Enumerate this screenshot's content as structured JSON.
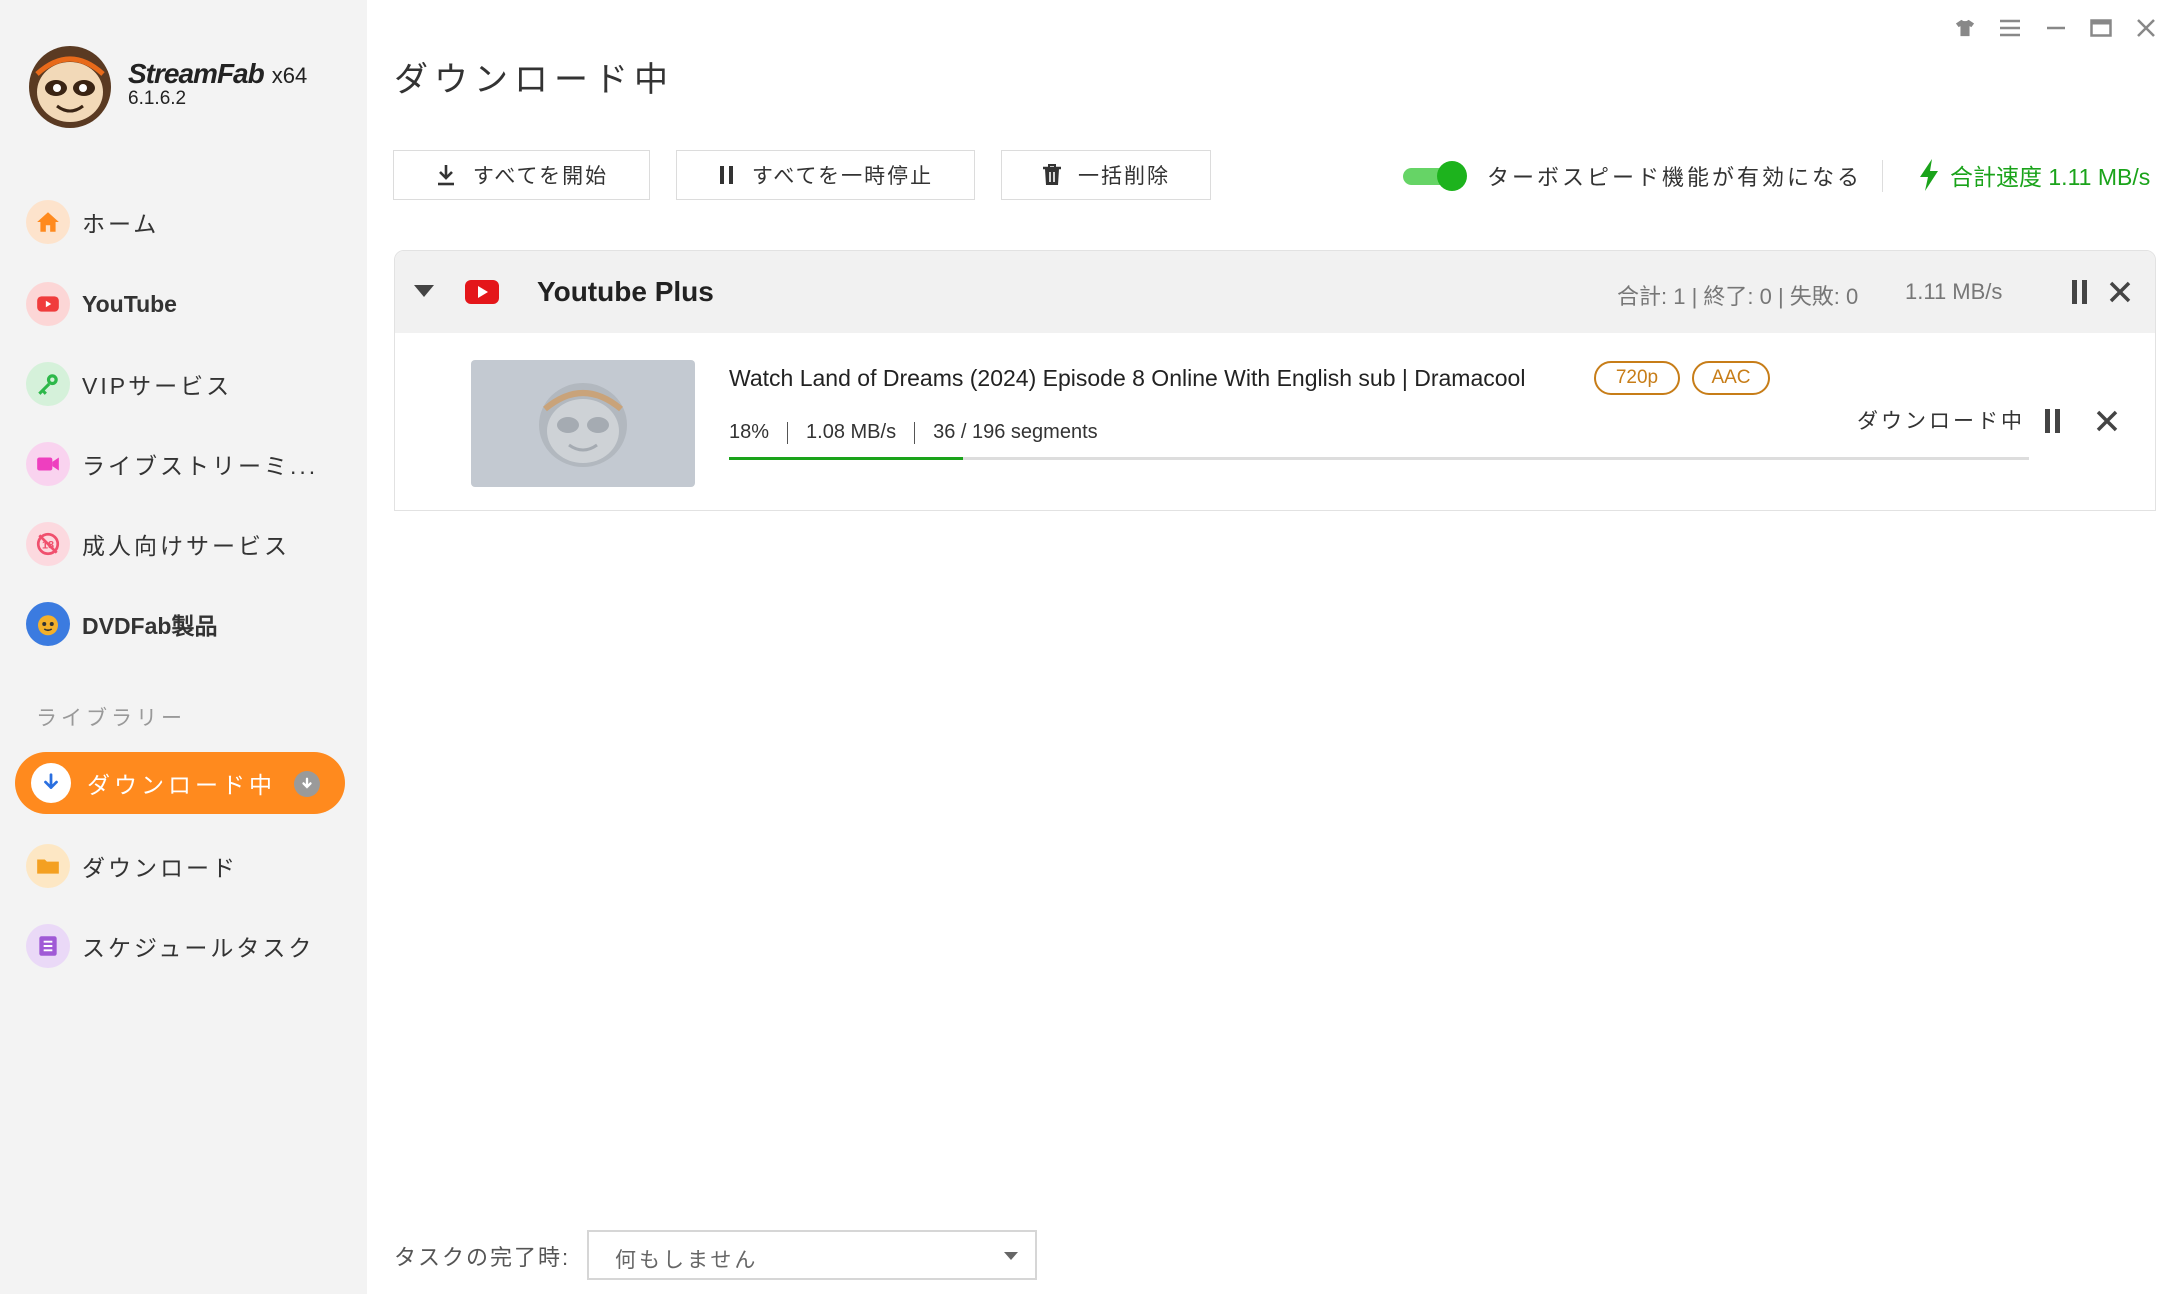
{
  "app": {
    "name": "StreamFab",
    "arch": "x64",
    "version": "6.1.6.2"
  },
  "sidebar": {
    "items": [
      {
        "label": "ホーム",
        "icon": "home-icon",
        "color": "#ff8a1e"
      },
      {
        "label": "YouTube",
        "icon": "youtube-icon",
        "color": "#f03c3c"
      },
      {
        "label": "VIPサービス",
        "icon": "key-icon",
        "color": "#2db84a"
      },
      {
        "label": "ライブストリーミ...",
        "icon": "live-camera-icon",
        "color": "#ee3fbf"
      },
      {
        "label": "成人向けサービス",
        "icon": "adult-restricted-icon",
        "color": "#f0506e"
      },
      {
        "label": "DVDFab製品",
        "icon": "dvdfab-logo-icon",
        "color": "#3b7be0"
      }
    ],
    "library_label": "ライブラリー",
    "library": [
      {
        "label": "ダウンロード中",
        "icon": "download-arrow-icon",
        "active": true
      },
      {
        "label": "ダウンロード",
        "icon": "folder-icon",
        "color": "#f4a021"
      },
      {
        "label": "スケジュールタスク",
        "icon": "schedule-list-icon",
        "color": "#a05ad6"
      }
    ]
  },
  "main": {
    "title": "ダウンロード中",
    "toolbar": {
      "start_all": "すべてを開始",
      "pause_all": "すべてを一時停止",
      "delete_all": "一括削除"
    },
    "turbo": {
      "enabled": true,
      "label": "ターボスピード機能が有効になる"
    },
    "total_speed": "合計速度 1.11 MB/s",
    "accent_color": "#1aa31a"
  },
  "group": {
    "name": "Youtube Plus",
    "stats": "合計: 1 | 終了: 0 | 失敗: 0",
    "speed": "1.11 MB/s",
    "items": [
      {
        "title": "Watch Land of Dreams (2024) Episode 8 Online With English sub | Dramacool",
        "quality": "720p",
        "audio": "AAC",
        "percent": "18%",
        "progress": 0.18,
        "speed": "1.08 MB/s",
        "segments": "36 / 196 segments",
        "status": "ダウンロード中"
      }
    ]
  },
  "footer": {
    "on_complete_label": "タスクの完了時:",
    "on_complete_value": "何もしません"
  }
}
